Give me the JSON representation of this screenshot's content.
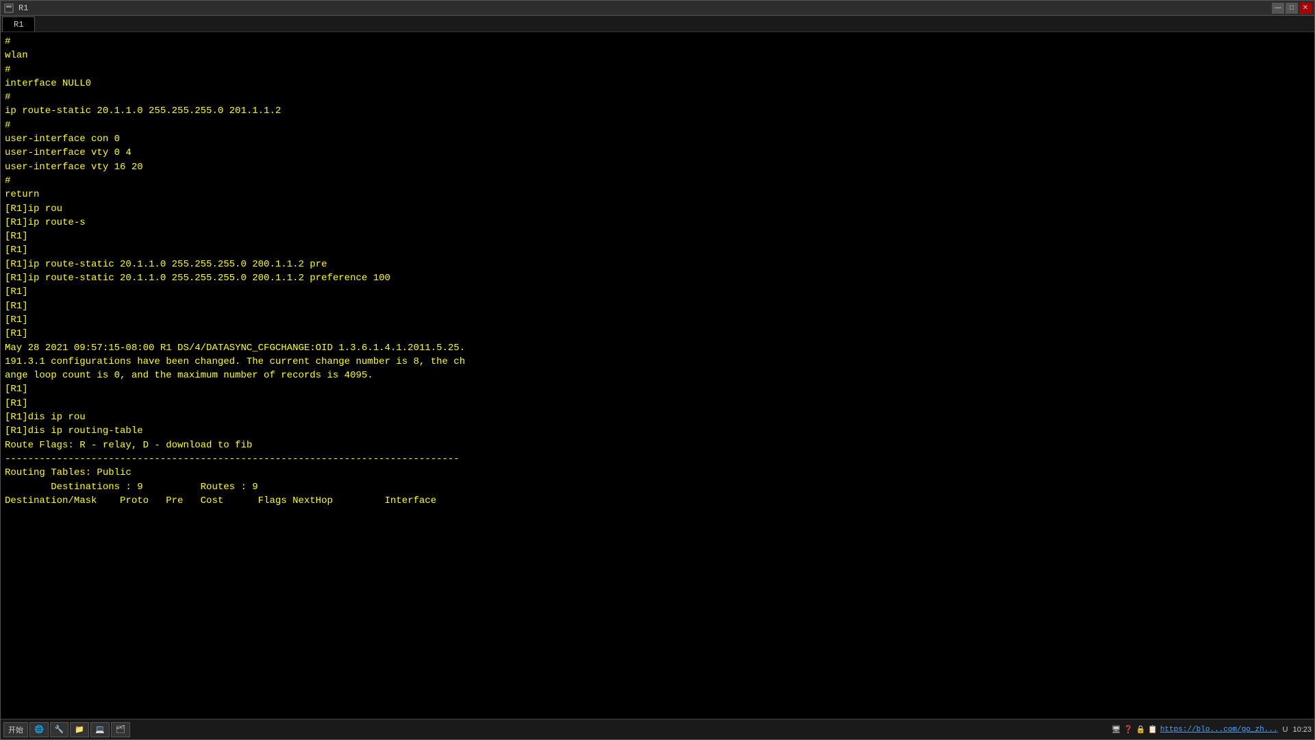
{
  "window": {
    "title": "R1",
    "tab_label": "R1"
  },
  "terminal": {
    "lines": [
      "#",
      "wlan",
      "#",
      "interface NULL0",
      "#",
      "ip route-static 20.1.1.0 255.255.255.0 201.1.1.2",
      "#",
      "user-interface con 0",
      "user-interface vty 0 4",
      "user-interface vty 16 20",
      "#",
      "return",
      "[R1]ip rou",
      "[R1]ip route-s",
      "[R1]",
      "[R1]",
      "[R1]ip route-static 20.1.1.0 255.255.255.0 200.1.1.2 pre",
      "[R1]ip route-static 20.1.1.0 255.255.255.0 200.1.1.2 preference 100",
      "[R1]",
      "[R1]",
      "[R1]",
      "[R1]",
      "May 28 2021 09:57:15-08:00 R1 DS/4/DATASYNC_CFGCHANGE:OID 1.3.6.1.4.1.2011.5.25.",
      "191.3.1 configurations have been changed. The current change number is 8, the ch",
      "ange loop count is 0, and the maximum number of records is 4095.",
      "[R1]",
      "[R1]",
      "[R1]dis ip rou",
      "[R1]dis ip routing-table",
      "Route Flags: R - relay, D - download to fib",
      "-------------------------------------------------------------------------------",
      "Routing Tables: Public",
      "        Destinations : 9          Routes : 9",
      "",
      "Destination/Mask    Proto   Pre   Cost      Flags NextHop         Interface"
    ]
  },
  "statusbar": {
    "icons": [
      "🖥",
      "?",
      "🔒",
      "📋"
    ],
    "url": "https://blo...com/go_zh...",
    "time": "10:23"
  },
  "taskbar": {
    "start_label": "开始",
    "items": [
      "🌐",
      "🔧",
      "📁",
      "💻",
      "🗂"
    ]
  }
}
